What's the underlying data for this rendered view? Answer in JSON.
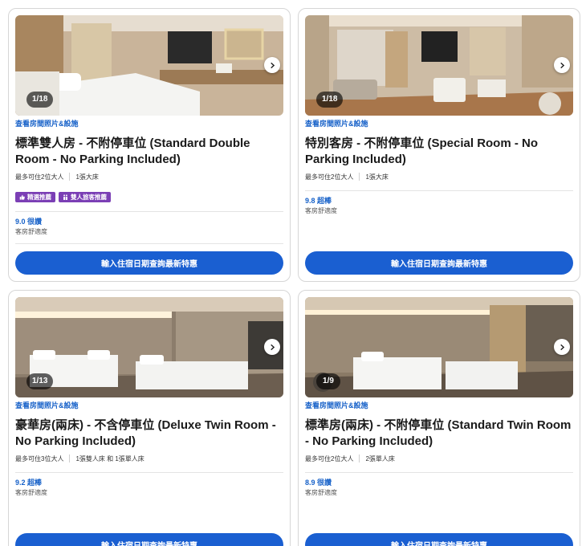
{
  "rooms": [
    {
      "photo_counter": "1/18",
      "photos_link": "查看房間照片&設施",
      "title": "標準雙人房 - 不附停車位 (Standard Double Room - No Parking Included)",
      "occupancy": "最多可住2位大人",
      "beds": "1張大床",
      "badges": [
        {
          "icon": "thumbs-up-icon",
          "label": "精選推薦"
        },
        {
          "icon": "couple-icon",
          "label": "雙人旅客推薦"
        }
      ],
      "rating": "9.0 很讚",
      "rating_label": "客房舒適度",
      "cta": "輸入住宿日期查詢最新特惠"
    },
    {
      "photo_counter": "1/18",
      "photos_link": "查看房間照片&設施",
      "title": "特別客房 - 不附停車位 (Special Room - No Parking Included)",
      "occupancy": "最多可住2位大人",
      "beds": "1張大床",
      "rating": "9.8 超棒",
      "rating_label": "客房舒適度",
      "cta": "輸入住宿日期查詢最新特惠"
    },
    {
      "photo_counter": "1/13",
      "photos_link": "查看房間照片&設施",
      "title": "豪華房(兩床) - 不含停車位 (Deluxe Twin Room - No Parking Included)",
      "occupancy": "最多可住3位大人",
      "beds": "1張雙人床 和 1張單人床",
      "rating": "9.2 超棒",
      "rating_label": "客房舒適度",
      "cta": "輸入住宿日期查詢最新特惠"
    },
    {
      "photo_counter": "1/9",
      "photos_link": "查看房間照片&設施",
      "title": "標準房(兩床) - 不附停車位 (Standard Twin Room - No Parking Included)",
      "occupancy": "最多可住2位大人",
      "beds": "2張單人床",
      "rating": "8.9 很讚",
      "rating_label": "客房舒適度",
      "cta": "輸入住宿日期查詢最新特惠"
    }
  ],
  "colors": {
    "link": "#1560c8",
    "cta": "#1a5fd1",
    "badge": "#7b3fb5"
  }
}
